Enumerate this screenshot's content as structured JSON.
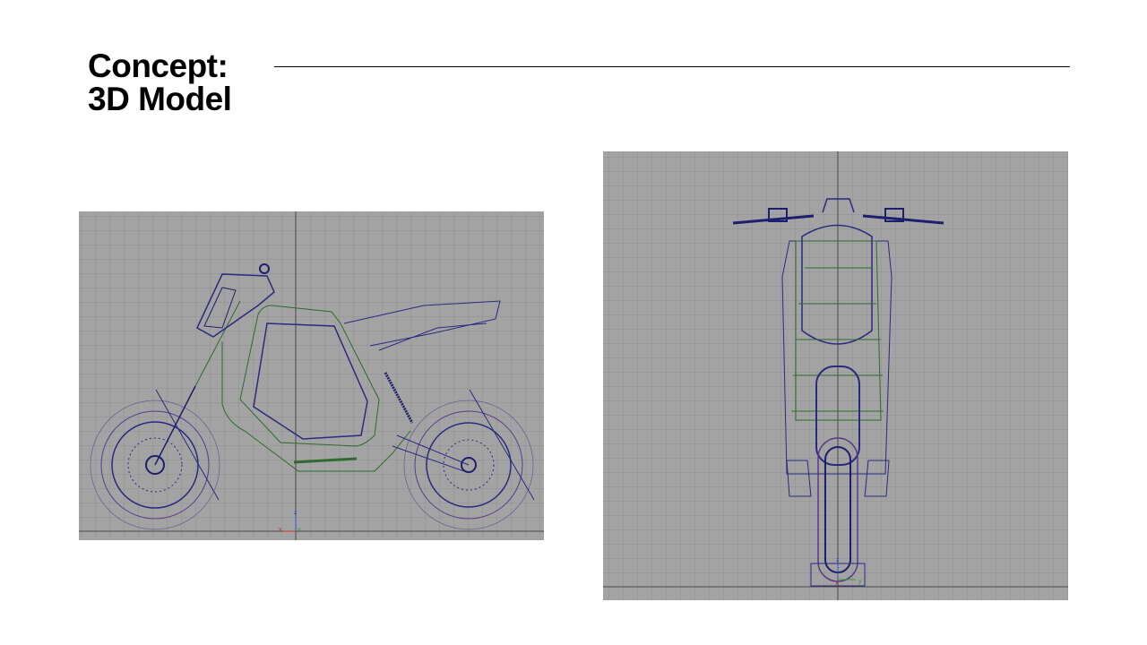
{
  "slide": {
    "title_line1": "Concept:",
    "title_line2": "3D Model"
  },
  "side_view": {
    "axis_labels": {
      "z": "z",
      "x": "x",
      "y": "y"
    }
  },
  "front_view": {
    "axis_labels": {
      "z": "z",
      "x": "x",
      "y": "y"
    }
  },
  "colors": {
    "viewport_bg": "#a3a3a3",
    "grid": "#8f8f8f",
    "wire_blue": "#2a2a80",
    "wire_green": "#2f6a2f",
    "wire_purple": "#5a3a8a"
  }
}
